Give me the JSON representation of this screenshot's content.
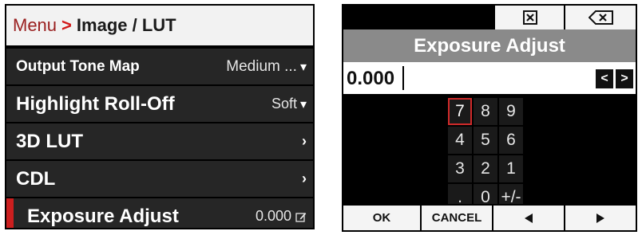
{
  "left_screen": {
    "breadcrumb": {
      "menu": "Menu",
      "separator": ">",
      "page": "Image / LUT"
    },
    "rows": [
      {
        "label": "Output Tone Map",
        "value": "Medium ...",
        "control": "chevron-down"
      },
      {
        "label": "Highlight Roll-Off",
        "value": "Soft",
        "control": "chevron-down"
      },
      {
        "label": "3D LUT",
        "value": "",
        "control": "arrow-right"
      },
      {
        "label": "CDL",
        "value": "",
        "control": "arrow-right"
      },
      {
        "label": "Exposure Adjust",
        "value": "0.000",
        "control": "edit",
        "selected": true
      }
    ],
    "colors": {
      "selection_marker": "#cc1f1f",
      "breadcrumb_menu": "#9a2020",
      "breadcrumb_separator": "#d21a1a"
    }
  },
  "right_screen": {
    "title": "Exposure Adjust",
    "input_value": "0.000",
    "keypad": {
      "keys": [
        "7",
        "8",
        "9",
        "4",
        "5",
        "6",
        "3",
        "2",
        "1",
        ".",
        "0",
        "+/-"
      ],
      "selected": "7"
    },
    "bottom_buttons": {
      "ok": "OK",
      "cancel": "CANCEL"
    },
    "icons": {
      "clear": "clear-x-icon",
      "backspace": "backspace-icon",
      "cursor_left": "cursor-left-icon",
      "cursor_right": "cursor-right-icon",
      "left": "left-triangle-icon",
      "right": "right-triangle-icon"
    }
  }
}
